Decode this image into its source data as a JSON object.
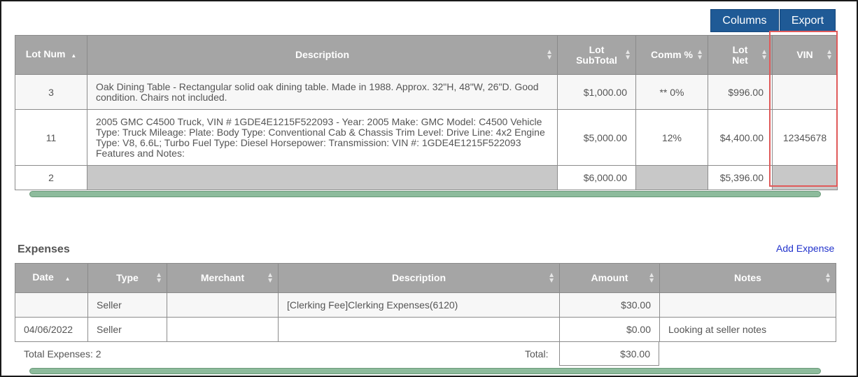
{
  "toolbar": {
    "columns_label": "Columns",
    "export_label": "Export"
  },
  "lots": {
    "headers": {
      "lot_num": "Lot Num",
      "description": "Description",
      "lot_subtotal_1": "Lot",
      "lot_subtotal_2": "SubTotal",
      "comm": "Comm %",
      "lot_net_1": "Lot",
      "lot_net_2": "Net",
      "vin": "VIN"
    },
    "rows": [
      {
        "lot_num": "3",
        "description": "Oak Dining Table - Rectangular solid oak dining table. Made in 1988. Approx. 32\"H, 48\"W, 26\"D. Good condition. Chairs not included.",
        "subtotal": "$1,000.00",
        "comm": "** 0%",
        "net": "$996.00",
        "vin": ""
      },
      {
        "lot_num": "11",
        "description": "2005 GMC C4500 Truck, VIN # 1GDE4E1215F522093 - Year: 2005 Make: GMC Model: C4500 Vehicle Type: Truck Mileage: Plate: Body Type: Conventional Cab & Chassis Trim Level: Drive Line: 4x2 Engine Type: V8, 6.6L; Turbo Fuel Type: Diesel Horsepower: Transmission: VIN #: 1GDE4E1215F522093 Features and Notes:",
        "subtotal": "$5,000.00",
        "comm": "12%",
        "net": "$4,400.00",
        "vin": "12345678"
      }
    ],
    "footer": {
      "count": "2",
      "subtotal": "$6,000.00",
      "net": "$5,396.00"
    }
  },
  "expenses": {
    "title": "Expenses",
    "add_label": "Add Expense",
    "headers": {
      "date": "Date",
      "type": "Type",
      "merchant": "Merchant",
      "description": "Description",
      "amount": "Amount",
      "notes": "Notes"
    },
    "rows": [
      {
        "date": "",
        "type": "Seller",
        "merchant": "",
        "description": "[Clerking Fee]Clerking Expenses(6120)",
        "amount": "$30.00",
        "notes": ""
      },
      {
        "date": "04/06/2022",
        "type": "Seller",
        "merchant": "",
        "description": "",
        "amount": "$0.00",
        "notes": "Looking at seller notes"
      }
    ],
    "total_count_label": "Total Expenses: 2",
    "total_label": "Total:",
    "total_amount": "$30.00"
  },
  "colors": {
    "header_bg": "#a5a5a5",
    "button_bg": "#1f5a96",
    "highlight": "#e05a5a",
    "scrollbar": "#8dbb9c",
    "link": "#2233cc"
  }
}
